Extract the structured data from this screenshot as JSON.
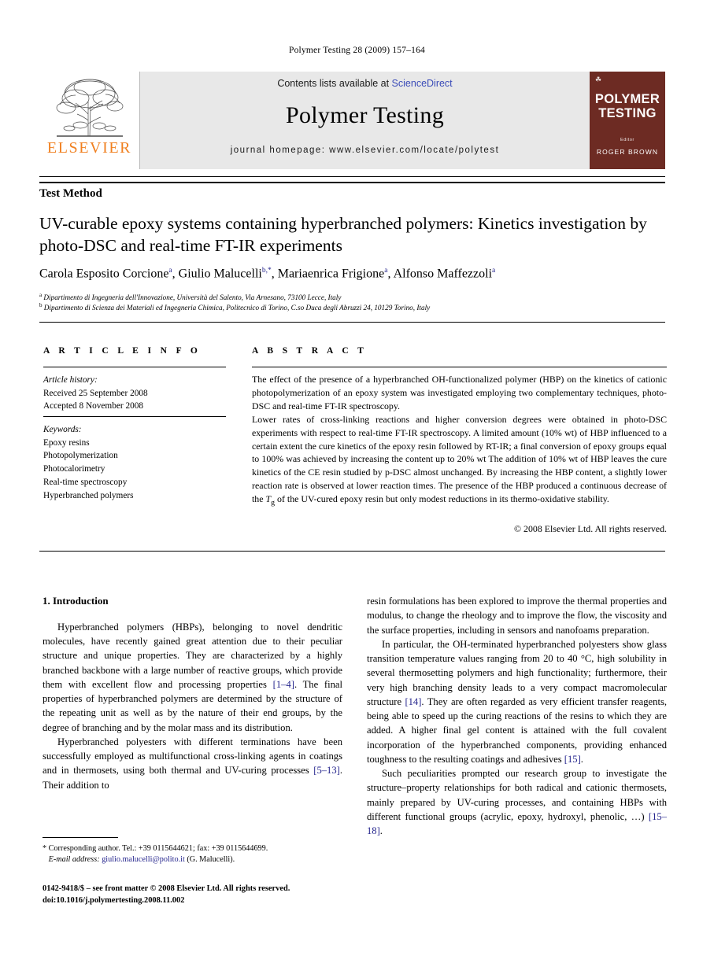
{
  "running_head": "Polymer Testing 28 (2009) 157–164",
  "masthead": {
    "contents_prefix": "Contents lists available at ",
    "sciencedirect": "ScienceDirect",
    "journal_title": "Polymer Testing",
    "homepage": "journal homepage: www.elsevier.com/locate/polytest",
    "publisher_word": "ELSEVIER",
    "cover": {
      "title_line1": "POLYMER",
      "title_line2": "TESTING",
      "editor_label": "Editor",
      "editor_name": "ROGER BROWN"
    },
    "colors": {
      "band_bg": "#e8e8e8",
      "elsevier_orange": "#F08020",
      "cover_maroon": "#6d2b23",
      "link_blue": "#3b4cb8",
      "reference_blue": "#23238c"
    }
  },
  "article": {
    "section_label": "Test Method",
    "title": "UV-curable epoxy systems containing hyperbranched polymers: Kinetics investigation by photo-DSC and real-time FT-IR experiments",
    "authors": [
      {
        "name": "Carola Esposito Corcione",
        "marks": "a"
      },
      {
        "name": "Giulio Malucelli",
        "marks": "b,*"
      },
      {
        "name": "Mariaenrica Frigione",
        "marks": "a"
      },
      {
        "name": "Alfonso Maffezzoli",
        "marks": "a"
      }
    ],
    "affiliations": [
      {
        "mark": "a",
        "text": "Dipartimento di Ingegneria dell'Innovazione, Università del Salento, Via Arnesano, 73100 Lecce, Italy"
      },
      {
        "mark": "b",
        "text": "Dipartimento di Scienza dei Materiali ed Ingegneria Chimica, Politecnico di Torino, C.so Duca degli Abruzzi 24, 10129 Torino, Italy"
      }
    ]
  },
  "info": {
    "heading": "A R T I C L E  I N F O",
    "history_label": "Article history:",
    "history": [
      "Received 25 September 2008",
      "Accepted 8 November 2008"
    ],
    "keywords_label": "Keywords:",
    "keywords": [
      "Epoxy resins",
      "Photopolymerization",
      "Photocalorimetry",
      "Real-time spectroscopy",
      "Hyperbranched polymers"
    ]
  },
  "abstract": {
    "heading": "A B S T R A C T",
    "paragraphs": [
      "The effect of the presence of a hyperbranched OH-functionalized polymer (HBP) on the kinetics of cationic photopolymerization of an epoxy system was investigated employing two complementary techniques, photo-DSC and real-time FT-IR spectroscopy.",
      "Lower rates of cross-linking reactions and higher conversion degrees were obtained in photo-DSC experiments with respect to real-time FT-IR spectroscopy. A limited amount (10% wt) of HBP influenced to a certain extent the cure kinetics of the epoxy resin followed by RT-IR; a final conversion of epoxy groups equal to 100% was achieved by increasing the content up to 20% wt The addition of 10% wt of HBP leaves the cure kinetics of the CE resin studied by p-DSC almost unchanged. By increasing the HBP content, a slightly lower reaction rate is observed at lower reaction times. The presence of the HBP produced a continuous decrease of the Tg of the UV-cured epoxy resin but only modest reductions in its thermo-oxidative stability."
    ],
    "copyright": "© 2008 Elsevier Ltd. All rights reserved."
  },
  "body": {
    "intro_heading": "1. Introduction",
    "left_paragraphs": [
      "Hyperbranched polymers (HBPs), belonging to novel dendritic molecules, have recently gained great attention due to their peculiar structure and unique properties. They are characterized by a highly branched backbone with a large number of reactive groups, which provide them with excellent flow and processing properties [1–4]. The final properties of hyperbranched polymers are determined by the structure of the repeating unit as well as by the nature of their end groups, by the degree of branching and by the molar mass and its distribution.",
      "Hyperbranched polyesters with different terminations have been successfully employed as multifunctional cross-linking agents in coatings and in thermosets, using both thermal and UV-curing processes [5–13]. Their addition to"
    ],
    "right_paragraphs": [
      "resin formulations has been explored to improve the thermal properties and modulus, to change the rheology and to improve the flow, the viscosity and the surface properties, including in sensors and nanofoams preparation.",
      "In particular, the OH-terminated hyperbranched polyesters show glass transition temperature values ranging from 20 to 40 °C, high solubility in several thermosetting polymers and high functionality; furthermore, their very high branching density leads to a very compact macromolecular structure [14]. They are often regarded as very efficient transfer reagents, being able to speed up the curing reactions of the resins to which they are added. A higher final gel content is attained with the full covalent incorporation of the hyperbranched components, providing enhanced toughness to the resulting coatings and adhesives [15].",
      "Such peculiarities prompted our research group to investigate the structure–property relationships for both radical and cationic thermosets, mainly prepared by UV-curing processes, and containing HBPs with different functional groups (acrylic, epoxy, hydroxyl, phenolic, …) [15–18]."
    ]
  },
  "footnotes": {
    "corresponding": "* Corresponding author. Tel.: +39 0115644621; fax: +39 0115644699.",
    "email_label": "E-mail address:",
    "email": "giulio.malucelli@polito.it",
    "email_owner": "(G. Malucelli).",
    "imprint_line1": "0142-9418/$ – see front matter © 2008 Elsevier Ltd. All rights reserved.",
    "imprint_line2": "doi:10.1016/j.polymertesting.2008.11.002"
  }
}
